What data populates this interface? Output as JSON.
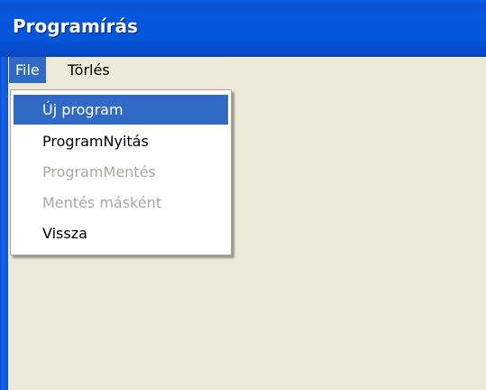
{
  "window": {
    "title": "Programírás"
  },
  "menu_bar": {
    "items": [
      {
        "label": "File"
      },
      {
        "label": "Törlés"
      }
    ]
  },
  "file_menu": {
    "items": [
      {
        "label": "Új program",
        "state": "selected"
      },
      {
        "label": "ProgramNyitás",
        "state": "enabled"
      },
      {
        "label": "ProgramMentés",
        "state": "disabled"
      },
      {
        "label": "Mentés másként",
        "state": "disabled"
      },
      {
        "label": "Vissza",
        "state": "enabled"
      }
    ]
  },
  "colors": {
    "title_bar": "#0556d9",
    "menu_highlight": "#316ac5",
    "window_background": "#ece9d8",
    "disabled_text": "#aca899"
  }
}
